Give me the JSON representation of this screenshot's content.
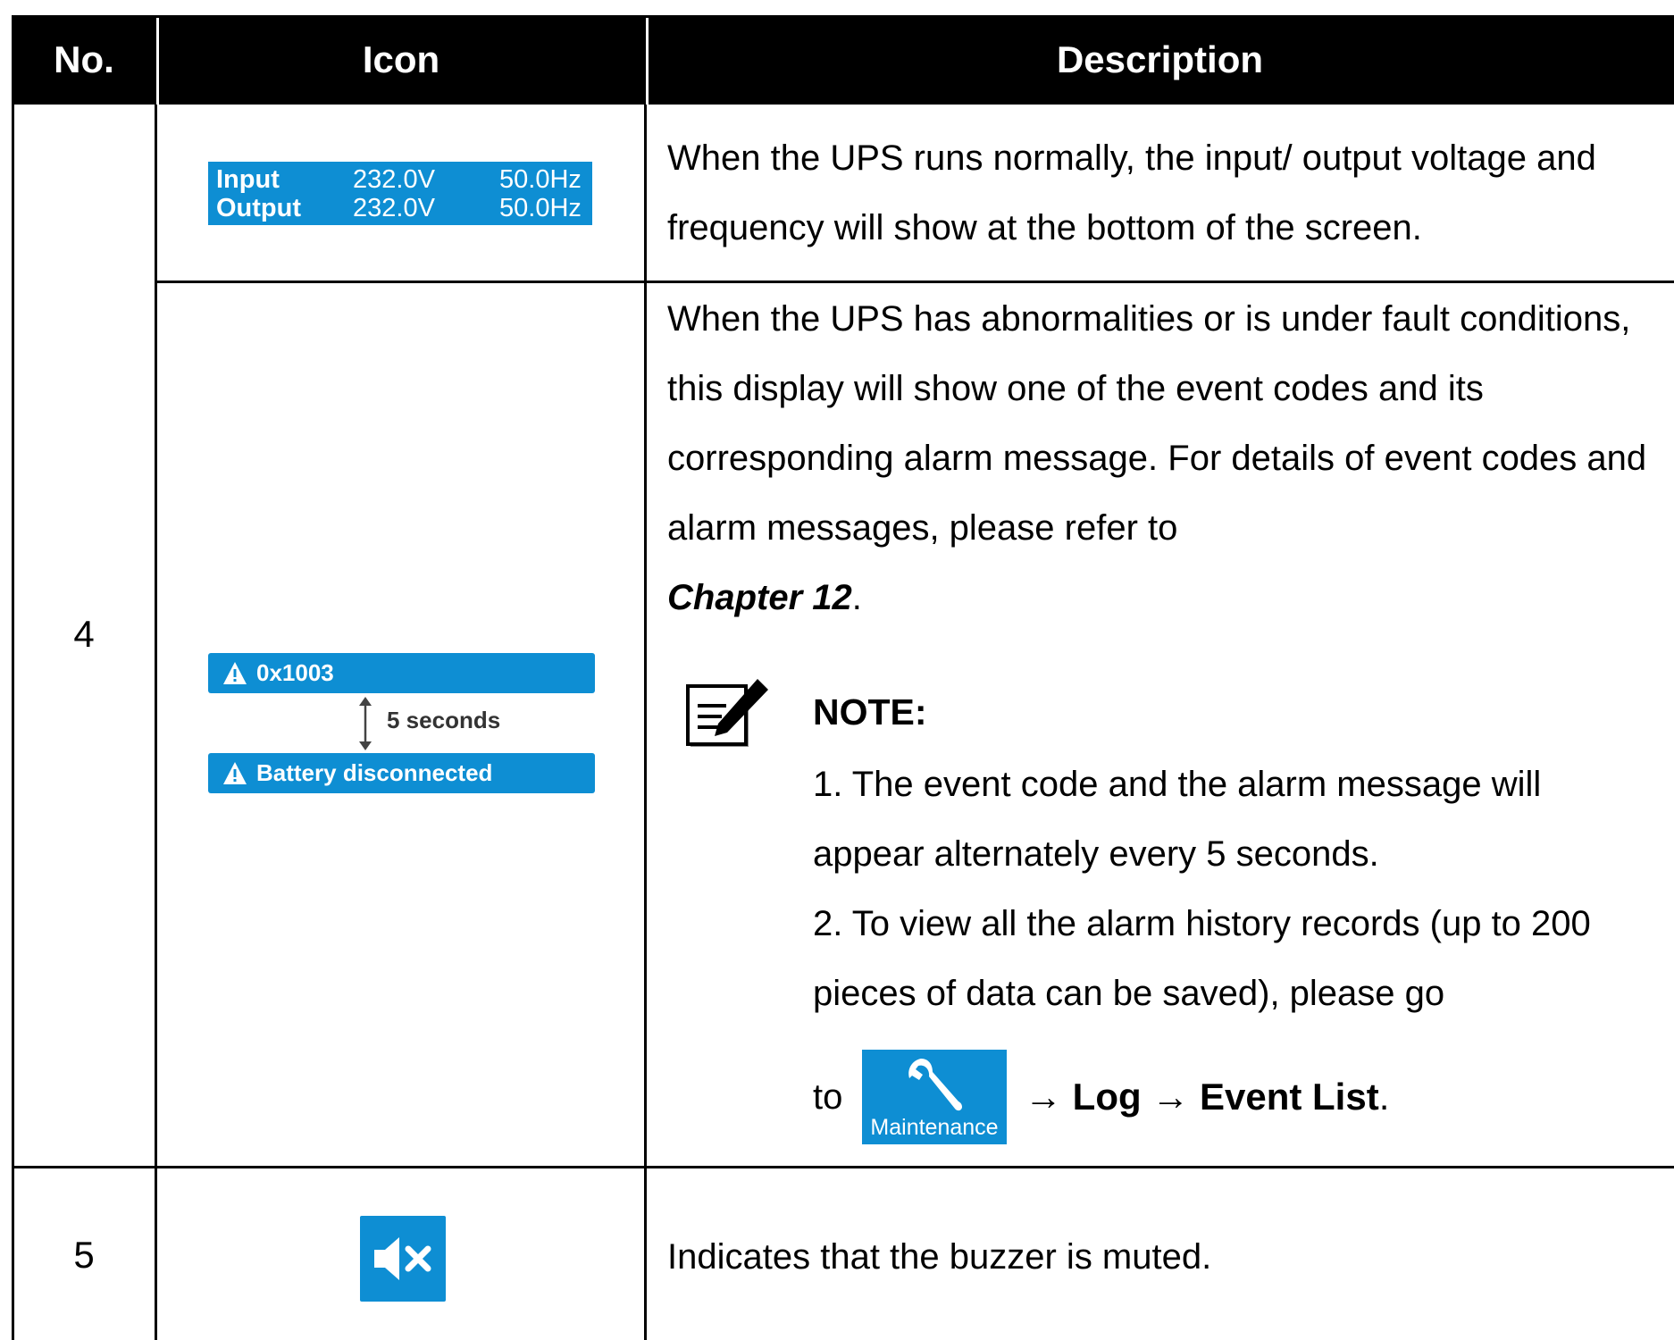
{
  "table": {
    "headers": {
      "no": "No.",
      "icon": "Icon",
      "description": "Description"
    },
    "rows": [
      {
        "no": "4",
        "lcd": {
          "input_label": "Input",
          "input_voltage": "232.0V",
          "input_freq": "50.0Hz",
          "output_label": "Output",
          "output_voltage": "232.0V",
          "output_freq": "50.0Hz"
        },
        "description": "When the UPS runs normally, the input/ output voltage and frequency will show at the bottom of the screen."
      },
      {
        "alarm": {
          "code": "0x1003",
          "interval": "5 seconds",
          "message": "Battery disconnected"
        },
        "description": "When the UPS has abnormalities or is under fault conditions, this display will show one of the event codes and its corresponding alarm message. For details of event codes and alarm messages, please refer to",
        "chapter_ref": "Chapter 12",
        "note": {
          "title": "NOTE:",
          "item1": "1. The event code and the alarm message will appear alternately every 5 seconds.",
          "item2": "2. To view all the alarm history records (up to 200 pieces of data can be saved), please go",
          "to": "to",
          "maintenance_label": "Maintenance",
          "arrow1": "→",
          "log": "Log",
          "arrow2": "→",
          "event_list": "Event List"
        }
      },
      {
        "no": "5",
        "description": "Indicates that the buzzer is muted."
      }
    ]
  },
  "colors": {
    "accent": "#0e8ed3",
    "header_bg": "#000000"
  },
  "icons": [
    "warning-icon",
    "double-arrow-icon",
    "note-pencil-icon",
    "wrench-icon",
    "mute-icon"
  ]
}
